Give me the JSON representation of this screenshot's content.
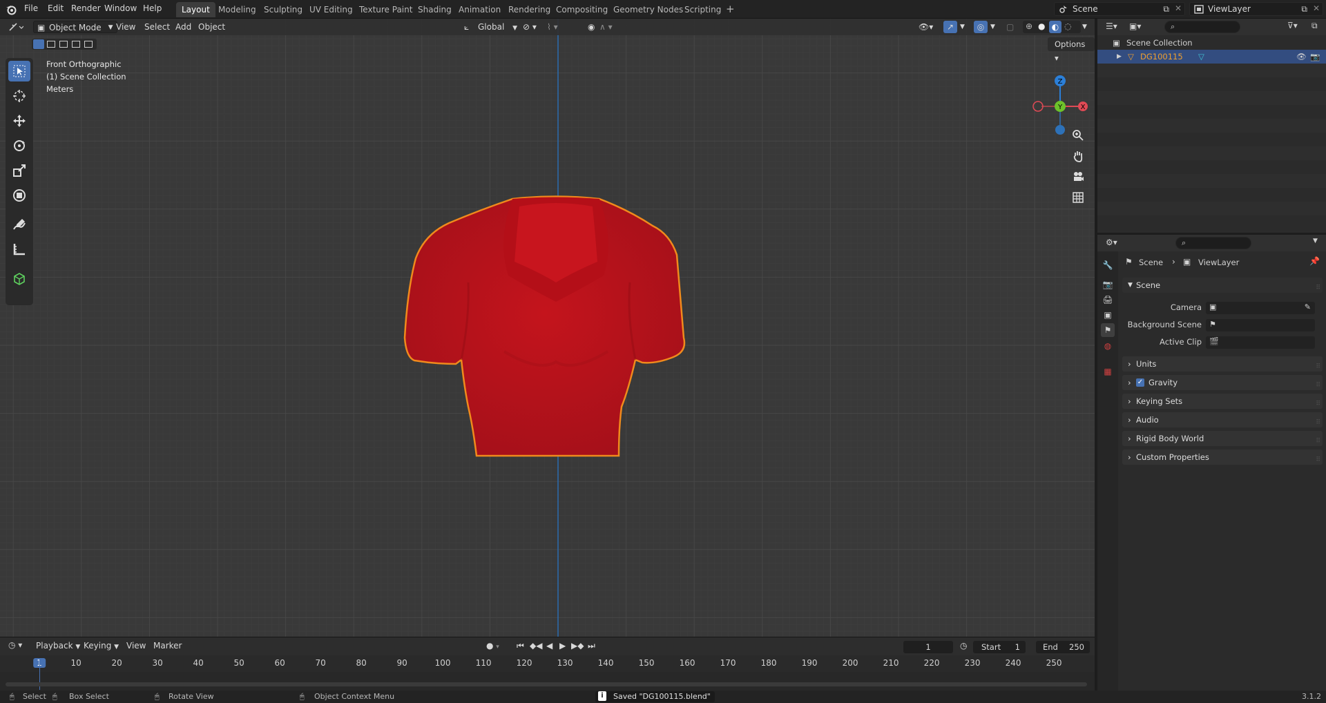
{
  "topbar": {
    "menus": [
      "File",
      "Edit",
      "Render",
      "Window",
      "Help"
    ],
    "workspaces": [
      "Layout",
      "Modeling",
      "Sculpting",
      "UV Editing",
      "Texture Paint",
      "Shading",
      "Animation",
      "Rendering",
      "Compositing",
      "Geometry Nodes",
      "Scripting"
    ],
    "active_workspace": "Layout",
    "scene": "Scene",
    "view_layer": "ViewLayer"
  },
  "viewport": {
    "mode": "Object Mode",
    "menus": [
      "View",
      "Select",
      "Add",
      "Object"
    ],
    "orientation": "Global",
    "options_label": "Options",
    "info": {
      "view_name": "Front Orthographic",
      "collection": "(1) Scene Collection",
      "units": "Meters"
    },
    "gizmo_axes": [
      "Z",
      "Y",
      "X"
    ],
    "object_color": "#c4141c",
    "outline_color": "#f08a1c"
  },
  "timeline": {
    "menus": [
      "Playback",
      "Keying",
      "View",
      "Marker"
    ],
    "current_frame": "1",
    "start_label": "Start",
    "start": "1",
    "end_label": "End",
    "end": "250",
    "ruler": [
      "1",
      "10",
      "20",
      "30",
      "40",
      "50",
      "60",
      "70",
      "80",
      "90",
      "100",
      "110",
      "120",
      "130",
      "140",
      "150",
      "160",
      "170",
      "180",
      "190",
      "200",
      "210",
      "220",
      "230",
      "240",
      "250"
    ]
  },
  "statusbar": {
    "select": "Select",
    "box_select": "Box Select",
    "rotate_view": "Rotate View",
    "context_menu": "Object Context Menu",
    "message": "Saved \"DG100115.blend\"",
    "version": "3.1.2"
  },
  "outliner": {
    "root": "Scene Collection",
    "object": "DG100115"
  },
  "properties": {
    "breadcrumb_scene": "Scene",
    "breadcrumb_layer": "ViewLayer",
    "panel_title": "Scene",
    "fields": [
      {
        "label": "Camera"
      },
      {
        "label": "Background Scene"
      },
      {
        "label": "Active Clip"
      }
    ],
    "sections": [
      "Units",
      "Gravity",
      "Keying Sets",
      "Audio",
      "Rigid Body World",
      "Custom Properties"
    ],
    "gravity_checked": true
  }
}
